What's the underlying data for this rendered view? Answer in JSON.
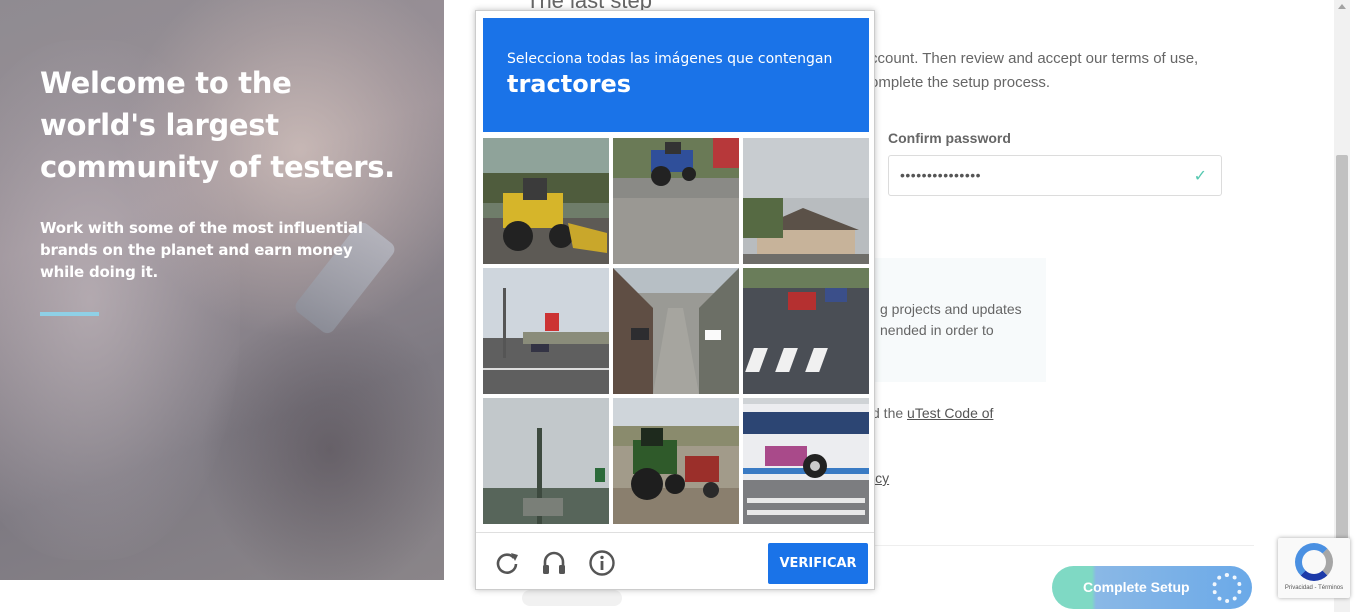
{
  "hero": {
    "headline": "Welcome to the world's largest community of testers.",
    "subline": "Work with some of the most influential brands on the planet and earn money while doing it.",
    "accent_color": "#8fd0e6"
  },
  "form": {
    "title": "The last step",
    "intro": "ccount. Then review and accept our terms of use, omplete the setup process.",
    "confirm_password_label": "Confirm password",
    "confirm_password_value": "•••••••••••••••",
    "confirm_valid_icon": "check-icon",
    "info_text": "g projects and updates nended in order to",
    "agree_prefix": "d the ",
    "code_link": "uTest Code of",
    "policy_link": "icy",
    "complete_button": "Complete Setup",
    "complete_colors": [
      "#7fd9c4",
      "#6aa9e8"
    ]
  },
  "captcha": {
    "instruction": "Selecciona todas las imágenes que contengan",
    "target": "tractores",
    "header_color": "#1a73e8",
    "tiles": [
      {
        "name": "tractor-loader"
      },
      {
        "name": "tractor-street"
      },
      {
        "name": "house-street"
      },
      {
        "name": "gas-station-road"
      },
      {
        "name": "residential-street"
      },
      {
        "name": "crosswalk-cars"
      },
      {
        "name": "traffic-light-pole"
      },
      {
        "name": "tractor-field"
      },
      {
        "name": "bus-crosswalk"
      }
    ],
    "footer": {
      "reload_icon": "reload-icon",
      "audio_icon": "headphones-icon",
      "info_icon": "info-icon",
      "verify_label": "VERIFICAR"
    }
  },
  "badge": {
    "links": "Privacidad - Términos"
  }
}
